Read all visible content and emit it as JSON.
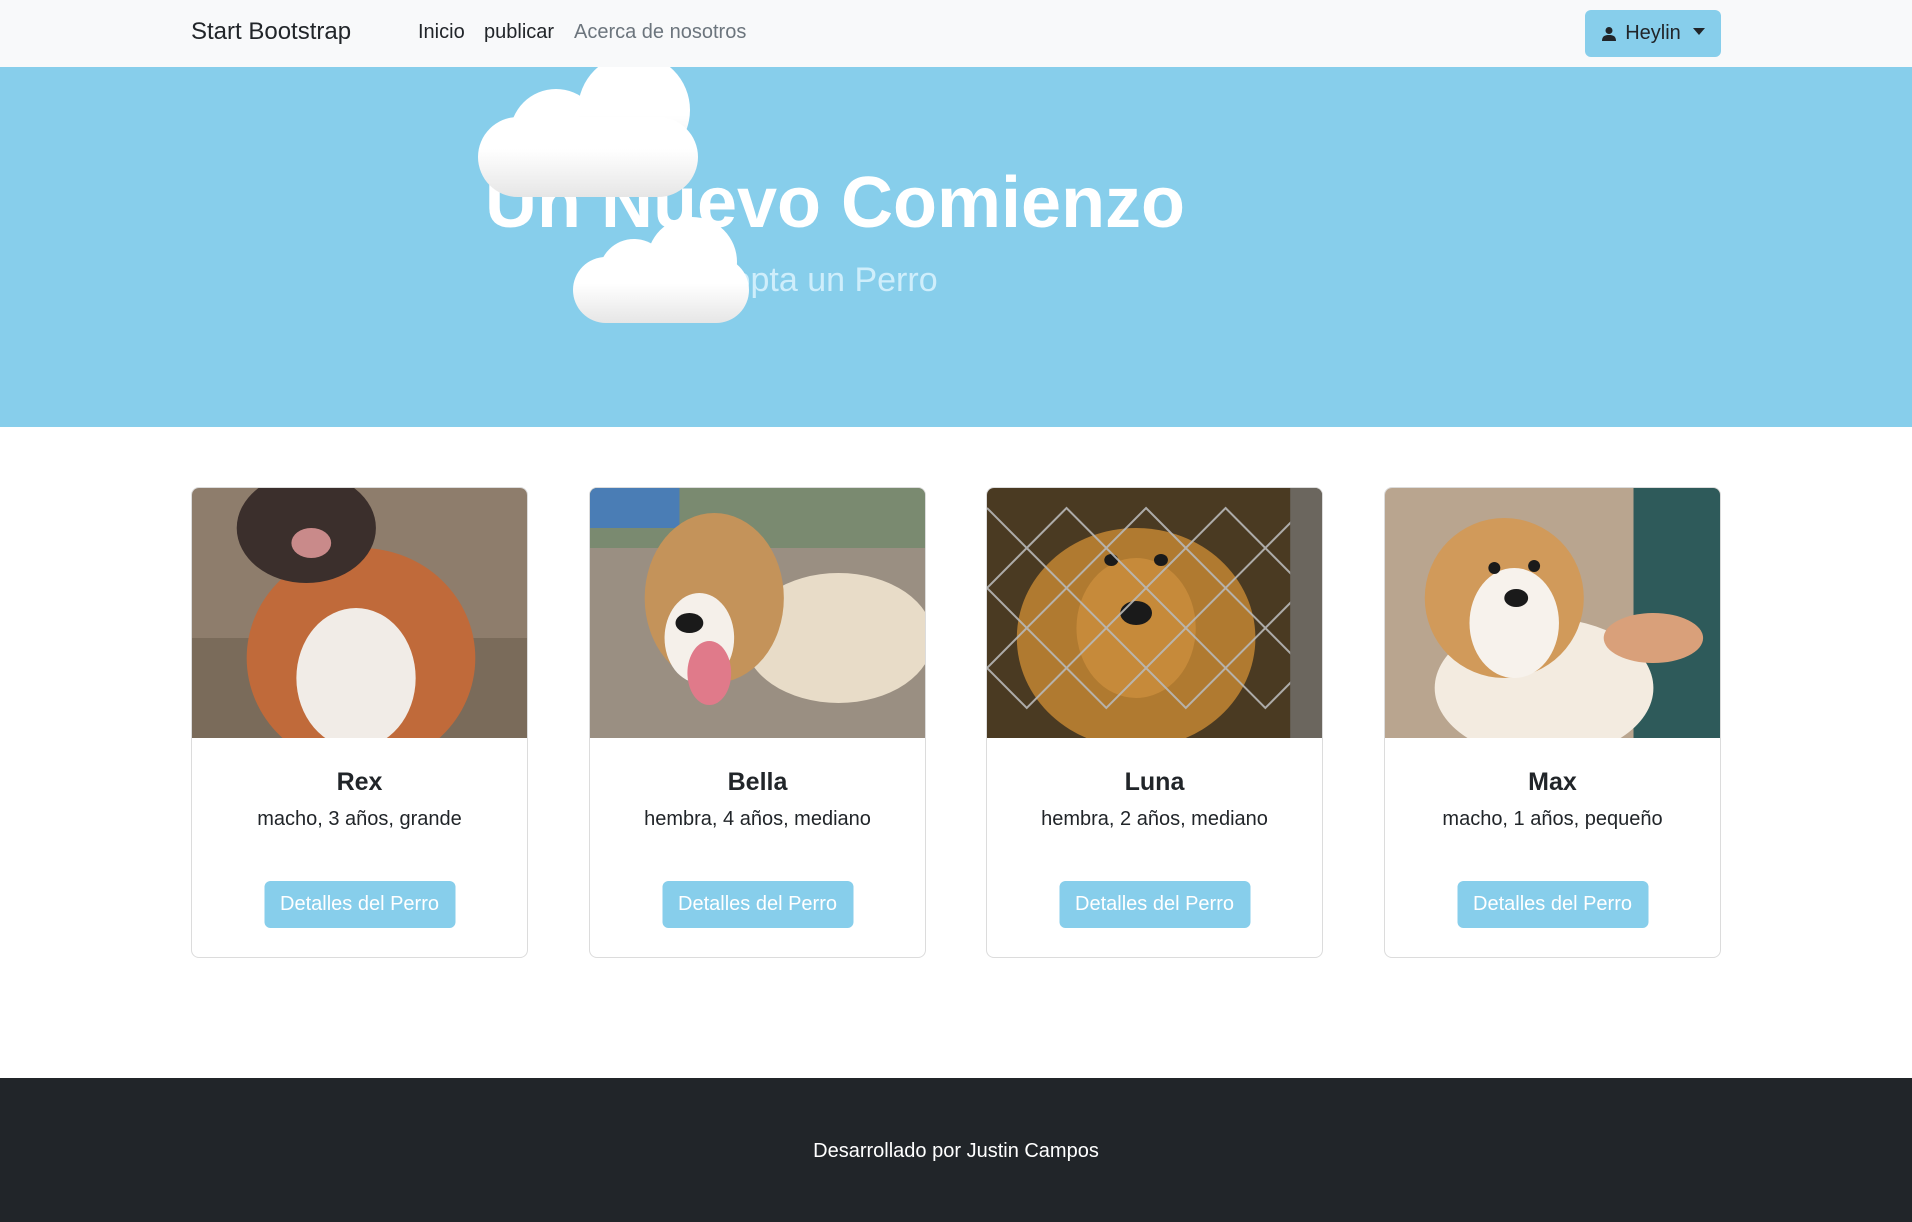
{
  "navbar": {
    "brand": "Start Bootstrap",
    "links": [
      "Inicio",
      "publicar",
      "Acerca de nosotros"
    ],
    "user": {
      "name": "Heylin",
      "icon": "user-icon"
    }
  },
  "hero": {
    "title": "Un Nuevo Comienzo",
    "subtitle": "Adopta un Perro",
    "background": "#87ceeb"
  },
  "dogs": [
    {
      "name": "Rex",
      "description": "macho, 3 años, grande",
      "button": "Detalles del Perro"
    },
    {
      "name": "Bella",
      "description": "hembra, 4 años, mediano",
      "button": "Detalles del Perro"
    },
    {
      "name": "Luna",
      "description": "hembra, 2 años, mediano",
      "button": "Detalles del Perro"
    },
    {
      "name": "Max",
      "description": "macho, 1 años, pequeño",
      "button": "Detalles del Perro"
    }
  ],
  "footer": {
    "text": "Desarrollado por Justin Campos"
  },
  "colors": {
    "accent": "#87ceeb",
    "footer": "#212529",
    "navbar": "#f8f9fa"
  }
}
